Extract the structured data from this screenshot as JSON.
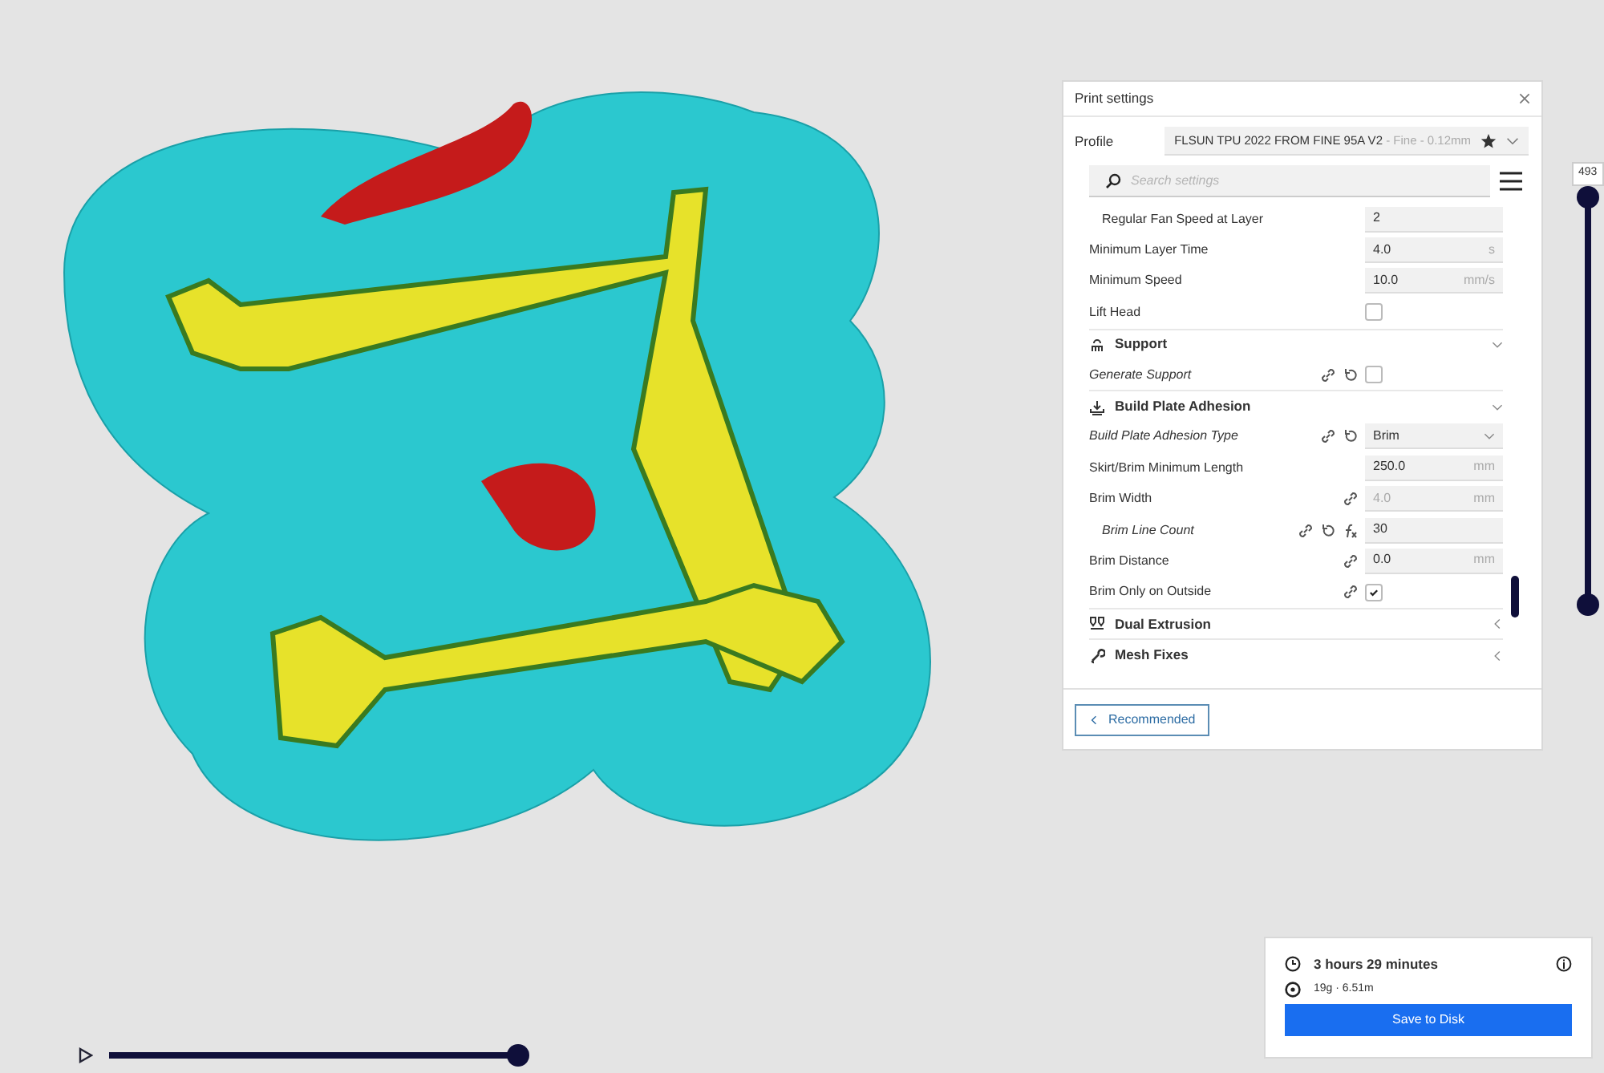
{
  "print_settings": {
    "title": "Print settings",
    "profile_label": "Profile",
    "profile_name": "FLSUN TPU 2022 FROM FINE 95A V2",
    "profile_quality": " - Fine - 0.12mm",
    "search": {
      "placeholder": "Search settings"
    },
    "settings": [
      {
        "kind": "group",
        "children": [
          {
            "kind": "input",
            "label": "Regular Fan Speed at Layer",
            "overridden": false,
            "linked": false,
            "resettable": false,
            "formula": false,
            "value": "2",
            "disabled": false
          }
        ]
      },
      {
        "kind": "input",
        "label": "Minimum Layer Time",
        "overridden": false,
        "linked": false,
        "resettable": false,
        "formula": false,
        "value": "4.0",
        "unit": "s",
        "disabled": false
      },
      {
        "kind": "input",
        "label": "Minimum Speed",
        "overridden": false,
        "linked": false,
        "resettable": false,
        "formula": false,
        "value": "10.0",
        "unit": "mm/s",
        "disabled": false
      },
      {
        "kind": "checkbox",
        "label": "Lift Head",
        "overridden": false,
        "linked": false,
        "resettable": false,
        "formula": false,
        "checked": false
      },
      {
        "kind": "category",
        "label": "Support",
        "expanded": true
      },
      {
        "kind": "checkbox",
        "label": "Generate Support",
        "overridden": true,
        "linked": true,
        "resettable": true,
        "formula": false,
        "checked": false
      },
      {
        "kind": "category",
        "label": "Build Plate Adhesion",
        "expanded": true
      },
      {
        "kind": "dropdown",
        "label": "Build Plate Adhesion Type",
        "overridden": true,
        "linked": true,
        "resettable": true,
        "formula": false,
        "value": "Brim"
      },
      {
        "kind": "input",
        "label": "Skirt/Brim Minimum Length",
        "overridden": false,
        "linked": false,
        "resettable": false,
        "formula": false,
        "value": "250.0",
        "unit": "mm",
        "disabled": false
      },
      {
        "kind": "input",
        "label": "Brim Width",
        "overridden": false,
        "linked": true,
        "resettable": false,
        "formula": false,
        "value": "4.0",
        "unit": "mm",
        "disabled": true,
        "children": [
          {
            "kind": "input",
            "label": "Brim Line Count",
            "overridden": true,
            "linked": true,
            "resettable": true,
            "formula": true,
            "value": "30",
            "disabled": false
          }
        ]
      },
      {
        "kind": "input",
        "label": "Brim Distance",
        "overridden": false,
        "linked": true,
        "resettable": false,
        "formula": false,
        "value": "0.0",
        "unit": "mm",
        "disabled": false
      },
      {
        "kind": "checkbox",
        "label": "Brim Only on Outside",
        "overridden": false,
        "linked": true,
        "resettable": false,
        "formula": false,
        "checked": true
      },
      {
        "kind": "category",
        "label": "Dual Extrusion",
        "expanded": false
      },
      {
        "kind": "category",
        "label": "Mesh Fixes",
        "expanded": false
      }
    ],
    "recommended_button": "Recommended"
  },
  "layer_slider": {
    "value": "493",
    "level": 1
  },
  "playback_slider": {
    "level": 1
  },
  "summary": {
    "time": "3 hours 29 minutes",
    "material": "19g · 6.51m",
    "save_button": "Save to Disk"
  }
}
